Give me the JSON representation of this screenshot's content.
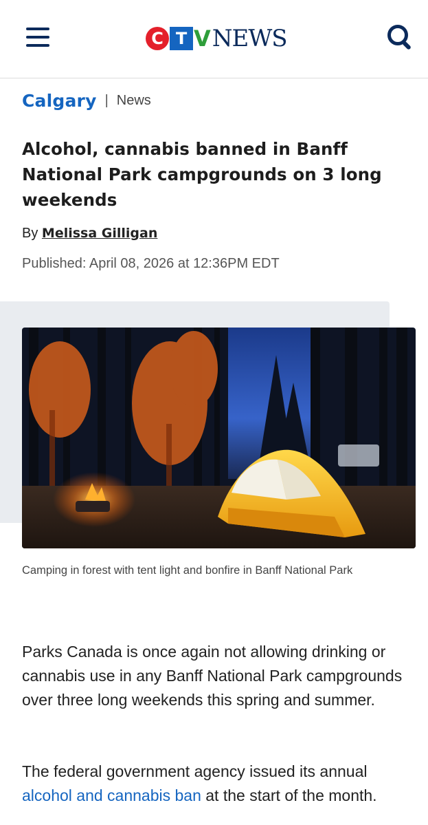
{
  "header": {
    "menu_icon": "hamburger-menu-icon",
    "logo": {
      "c": "C",
      "t": "T",
      "v": "V",
      "news": "NEWS"
    },
    "search_icon": "search-icon"
  },
  "breadcrumb": {
    "city": "Calgary",
    "separator": "|",
    "section": "News"
  },
  "article": {
    "headline": "Alcohol, cannabis banned in Banff National Park campgrounds on 3 long weekends",
    "by_prefix": "By",
    "author": "Melissa Gilligan",
    "published": "Published: April 08, 2026 at 12:36PM EDT",
    "image_caption": "Camping in forest with tent light and bonfire in Banff National Park",
    "paragraph1": "Parks Canada is once again not allowing drinking or cannabis use in any Banff National Park campgrounds over three long weekends this spring and summer.",
    "paragraph2_start": "The federal government agency issued its annual ",
    "paragraph2_link": "alcohol and cannabis ban",
    "paragraph2_end": " at the start of the month."
  },
  "colors": {
    "brand_navy": "#0b2a5b",
    "link_blue": "#1565c0",
    "logo_red": "#e4202b",
    "logo_green": "#2e9e3a"
  }
}
